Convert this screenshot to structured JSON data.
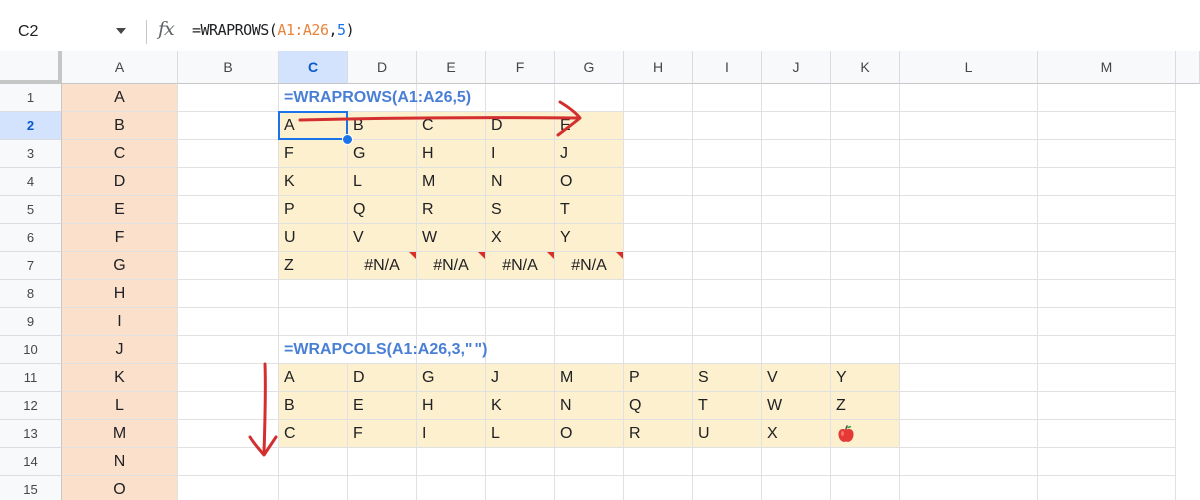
{
  "formula_bar": {
    "name_box": "C2",
    "fx_label": "fx",
    "formula": {
      "func": "=WRAPROWS(",
      "range": "A1:A26",
      "sep": ",",
      "num": "5",
      "close": ")"
    }
  },
  "columns": [
    "A",
    "B",
    "C",
    "D",
    "E",
    "F",
    "G",
    "H",
    "I",
    "J",
    "K",
    "L",
    "M"
  ],
  "selected_column": "C",
  "rows": [
    "1",
    "2",
    "3",
    "4",
    "5",
    "6",
    "7",
    "8",
    "9",
    "10",
    "11",
    "12",
    "13",
    "14",
    "15"
  ],
  "selected_row": "2",
  "column_a_values": [
    "A",
    "B",
    "C",
    "D",
    "E",
    "F",
    "G",
    "H",
    "I",
    "J",
    "K",
    "L",
    "M",
    "N",
    "O"
  ],
  "wraprows": {
    "label": "=WRAPROWS(A1:A26,5)",
    "grid": [
      [
        "A",
        "B",
        "C",
        "D",
        "E"
      ],
      [
        "F",
        "G",
        "H",
        "I",
        "J"
      ],
      [
        "K",
        "L",
        "M",
        "N",
        "O"
      ],
      [
        "P",
        "Q",
        "R",
        "S",
        "T"
      ],
      [
        "U",
        "V",
        "W",
        "X",
        "Y"
      ],
      [
        "Z",
        "#N/A",
        "#N/A",
        "#N/A",
        "#N/A"
      ]
    ]
  },
  "wrapcols": {
    "label_pre": "=WRAPCOLS(A1:A26,3,\"",
    "label_post": "\")",
    "pad_icon": "apple-icon",
    "grid": [
      [
        "A",
        "D",
        "G",
        "J",
        "M",
        "P",
        "S",
        "V",
        "Y"
      ],
      [
        "B",
        "E",
        "H",
        "K",
        "N",
        "Q",
        "T",
        "W",
        "Z"
      ],
      [
        "C",
        "F",
        "I",
        "L",
        "O",
        "R",
        "U",
        "X",
        "apple-icon"
      ]
    ]
  },
  "colors": {
    "selection": "#1a73e8",
    "arrow": "#d32f2f",
    "source_fill": "#fbe0cc",
    "result_fill": "#fdf0cf",
    "error_marker": "#d93025"
  }
}
